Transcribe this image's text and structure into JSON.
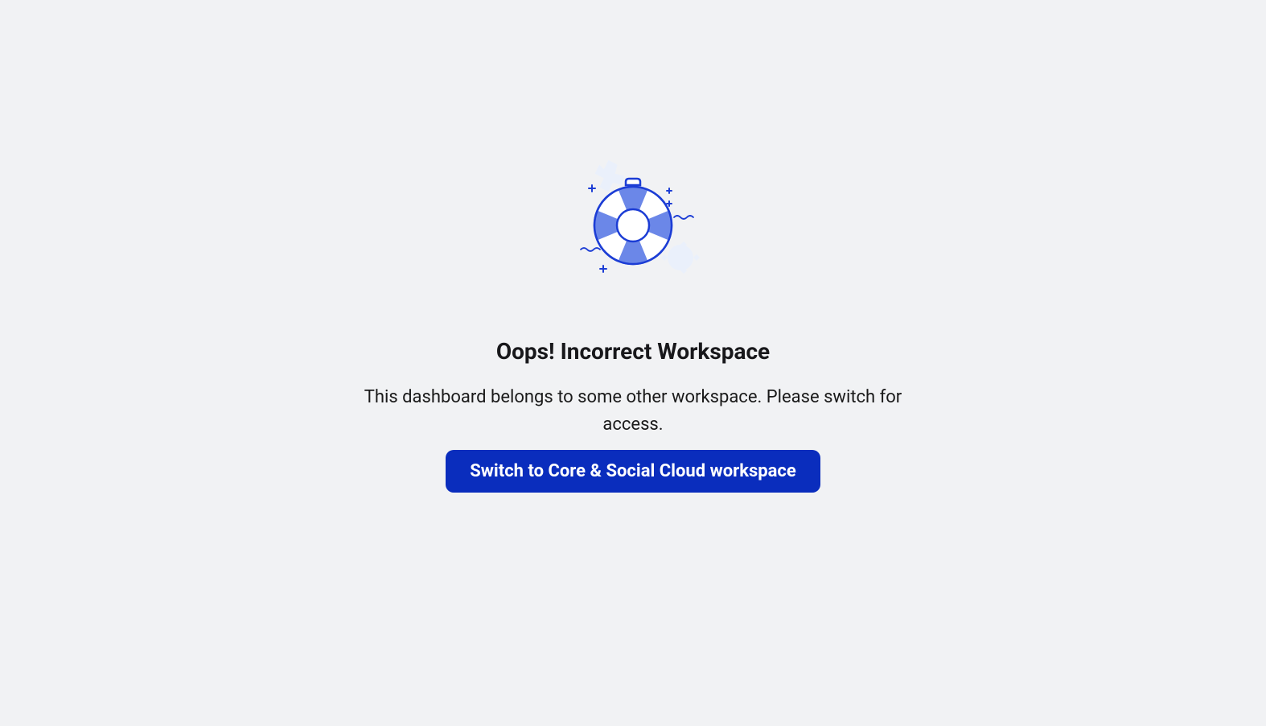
{
  "error": {
    "heading": "Oops! Incorrect Workspace",
    "description": "This dashboard belongs to some other workspace. Please switch for access.",
    "button_label": "Switch to Core & Social Cloud workspace"
  }
}
